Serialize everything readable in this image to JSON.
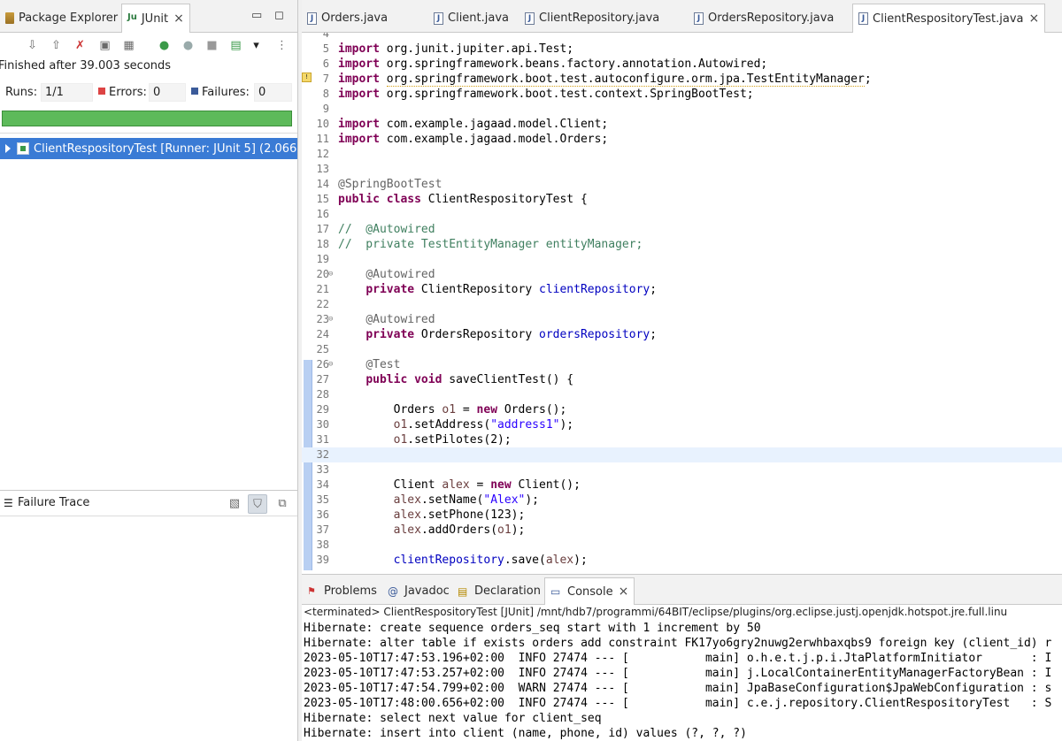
{
  "left_view": {
    "tabs": [
      {
        "label": "Package Explorer",
        "icon": "package-explorer-icon"
      },
      {
        "label": "JUnit",
        "icon": "junit-icon",
        "active": true
      }
    ],
    "minimize_symbol": "▭",
    "maximize_symbol": "◻",
    "close_symbol": "×",
    "status": "Finished after 39.003 seconds",
    "runs_label": "Runs:",
    "runs_value": "1/1",
    "errors_label": "Errors:",
    "errors_value": "0",
    "failures_label": "Failures:",
    "failures_value": "0",
    "progress": 1.0,
    "tree_item": "ClientRespositoryTest [Runner: JUnit 5] (2.066",
    "failure_trace_title": "Failure Trace"
  },
  "editor": {
    "tabs": [
      {
        "label": "Orders.java"
      },
      {
        "label": "Client.java"
      },
      {
        "label": "ClientRepository.java"
      },
      {
        "label": "OrdersRepository.java"
      },
      {
        "label": "ClientRespositoryTest.java",
        "active": true
      }
    ],
    "lines": [
      {
        "n": "4",
        "html": ""
      },
      {
        "n": "5",
        "html": "<span class=\"kw\">import</span> org.junit.jupiter.api.Test;"
      },
      {
        "n": "6",
        "html": "<span class=\"kw\">import</span> org.springframework.beans.factory.annotation.Autowired;"
      },
      {
        "n": "7",
        "html": "<span class=\"kw\">import</span> <span class=\"warn\">org.springframework.boot.test.autoconfigure.orm.jpa.TestEntityManager</span>;",
        "marker": true
      },
      {
        "n": "8",
        "html": "<span class=\"kw\">import</span> org.springframework.boot.test.context.SpringBootTest;"
      },
      {
        "n": "9",
        "html": ""
      },
      {
        "n": "10",
        "html": "<span class=\"kw\">import</span> com.example.jagaad.model.Client;"
      },
      {
        "n": "11",
        "html": "<span class=\"kw\">import</span> com.example.jagaad.model.Orders;"
      },
      {
        "n": "12",
        "html": ""
      },
      {
        "n": "13",
        "html": ""
      },
      {
        "n": "14",
        "html": "<span class=\"ann\">@SpringBootTest</span>"
      },
      {
        "n": "15",
        "html": "<span class=\"kw\">public</span> <span class=\"kw\">class</span> ClientRespositoryTest {"
      },
      {
        "n": "16",
        "html": ""
      },
      {
        "n": "17",
        "html": "<span class=\"cmt\">//  @Autowired</span>"
      },
      {
        "n": "18",
        "html": "<span class=\"cmt\">//  private TestEntityManager entityManager;</span>"
      },
      {
        "n": "19",
        "html": ""
      },
      {
        "n": "20",
        "html": "    <span class=\"ann\">@Autowired</span>",
        "fold": true
      },
      {
        "n": "21",
        "html": "    <span class=\"kw\">private</span> ClientRepository <span class=\"fld\">clientRepository</span>;"
      },
      {
        "n": "22",
        "html": ""
      },
      {
        "n": "23",
        "html": "    <span class=\"ann\">@Autowired</span>",
        "fold": true
      },
      {
        "n": "24",
        "html": "    <span class=\"kw\">private</span> OrdersRepository <span class=\"fld\">ordersRepository</span>;"
      },
      {
        "n": "25",
        "html": ""
      },
      {
        "n": "26",
        "html": "    <span class=\"ann\">@Test</span>",
        "fold": true
      },
      {
        "n": "27",
        "html": "    <span class=\"kw\">public</span> <span class=\"kw\">void</span> saveClientTest() {"
      },
      {
        "n": "28",
        "html": ""
      },
      {
        "n": "29",
        "html": "        Orders <span style=\"color:#6a3e3e\">o1</span> = <span class=\"kw\">new</span> Orders();"
      },
      {
        "n": "30",
        "html": "        <span style=\"color:#6a3e3e\">o1</span>.setAddress(<span class=\"str\">\"address1\"</span>);"
      },
      {
        "n": "31",
        "html": "        <span style=\"color:#6a3e3e\">o1</span>.setPilotes(2);"
      },
      {
        "n": "32",
        "html": "",
        "current": true
      },
      {
        "n": "33",
        "html": ""
      },
      {
        "n": "34",
        "html": "        Client <span style=\"color:#6a3e3e\">alex</span> = <span class=\"kw\">new</span> Client();"
      },
      {
        "n": "35",
        "html": "        <span style=\"color:#6a3e3e\">alex</span>.setName(<span class=\"str\">\"Alex\"</span>);"
      },
      {
        "n": "36",
        "html": "        <span style=\"color:#6a3e3e\">alex</span>.setPhone(123);"
      },
      {
        "n": "37",
        "html": "        <span style=\"color:#6a3e3e\">alex</span>.addOrders(<span style=\"color:#6a3e3e\">o1</span>);"
      },
      {
        "n": "38",
        "html": ""
      },
      {
        "n": "39",
        "html": "        <span class=\"fld\">clientRepository</span>.save(<span style=\"color:#6a3e3e\">alex</span>);"
      }
    ]
  },
  "console_view": {
    "tabs": [
      {
        "label": "Problems",
        "icon": "problems-icon"
      },
      {
        "label": "Javadoc",
        "icon": "javadoc-icon"
      },
      {
        "label": "Declaration",
        "icon": "declaration-icon"
      },
      {
        "label": "Console",
        "icon": "console-icon",
        "active": true
      }
    ],
    "terminated": "<terminated> ClientRespositoryTest [JUnit] /mnt/hdb7/programmi/64BIT/eclipse/plugins/org.eclipse.justj.openjdk.hotspot.jre.full.linu",
    "lines": [
      "Hibernate: create sequence orders_seq start with 1 increment by 50",
      "Hibernate: alter table if exists orders add constraint FK17yo6gry2nuwg2erwhbaxqbs9 foreign key (client_id) r",
      "2023-05-10T17:47:53.196+02:00  INFO 27474 --- [           main] o.h.e.t.j.p.i.JtaPlatformInitiator       : I",
      "2023-05-10T17:47:53.257+02:00  INFO 27474 --- [           main] j.LocalContainerEntityManagerFactoryBean : I",
      "2023-05-10T17:47:54.799+02:00  WARN 27474 --- [           main] JpaBaseConfiguration$JpaWebConfiguration : s",
      "2023-05-10T17:48:00.656+02:00  INFO 27474 --- [           main] c.e.j.repository.ClientRespositoryTest   : S",
      "Hibernate: select next value for client_seq",
      "Hibernate: insert into client (name, phone, id) values (?, ?, ?)"
    ]
  },
  "colors": {
    "progress_ok": "#5dba5a",
    "selection": "#3a7bd5",
    "keyword": "#7f0055",
    "string": "#2a00ff",
    "comment": "#3f7f5f",
    "field": "#0000c0"
  }
}
